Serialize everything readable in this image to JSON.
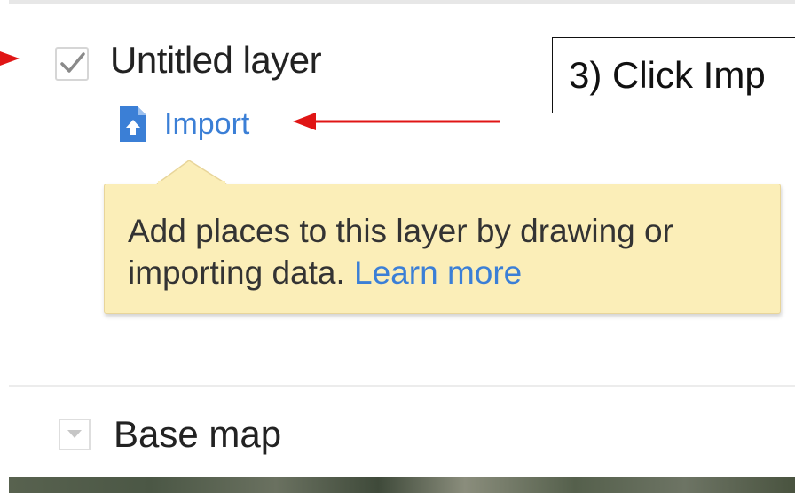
{
  "layer": {
    "title": "Untitled layer",
    "checked": true,
    "import_label": "Import"
  },
  "tooltip": {
    "text": "Add places to this layer by drawing or importing data. ",
    "link": "Learn more"
  },
  "callout": {
    "text": "3) Click Imp"
  },
  "base_map": {
    "title": "Base map"
  },
  "colors": {
    "link_blue": "#3b7fd6",
    "annotation_red": "#e01515",
    "tooltip_bg": "#fbeeb8"
  }
}
